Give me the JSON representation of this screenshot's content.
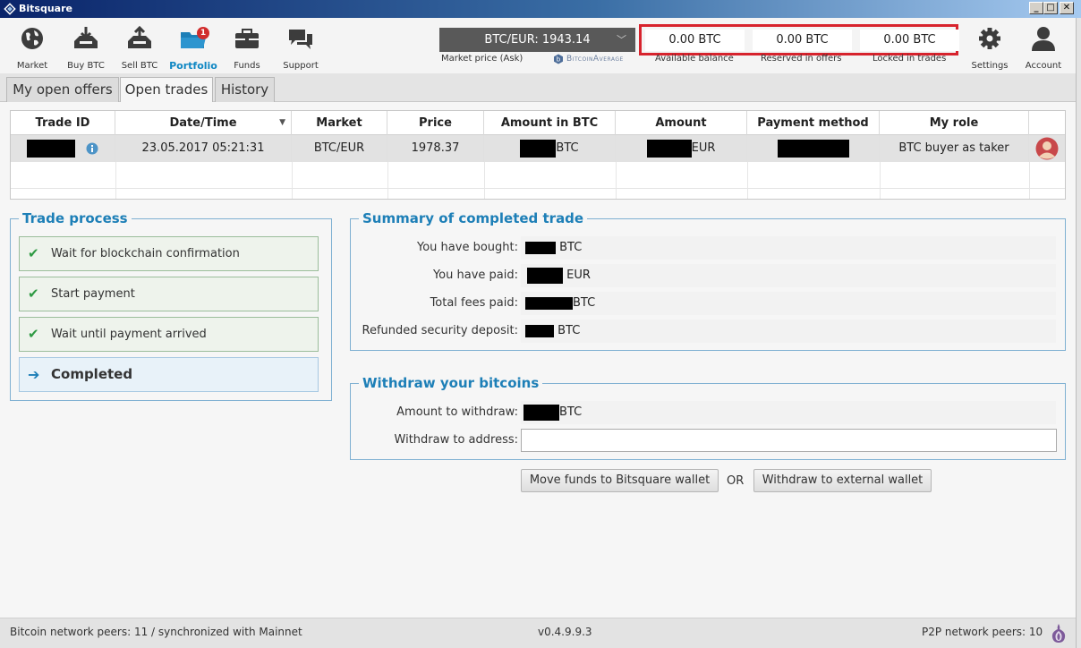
{
  "window": {
    "title": "Bitsquare"
  },
  "nav": {
    "market": "Market",
    "buy_btc": "Buy BTC",
    "sell_btc": "Sell BTC",
    "portfolio": "Portfolio",
    "portfolio_badge": "1",
    "funds": "Funds",
    "support": "Support",
    "settings": "Settings",
    "account": "Account"
  },
  "market_price": {
    "value": "BTC/EUR: 1943.14",
    "label": "Market price (Ask)",
    "provider": "BitcoinAverage"
  },
  "balances": {
    "available": {
      "value": "0.00 BTC",
      "label": "Available balance"
    },
    "reserved": {
      "value": "0.00 BTC",
      "label": "Reserved in offers"
    },
    "locked": {
      "value": "0.00 BTC",
      "label": "Locked in trades"
    }
  },
  "tabs": [
    "My open offers",
    "Open trades",
    "History"
  ],
  "table": {
    "headers": [
      "Trade ID",
      "Date/Time",
      "Market",
      "Price",
      "Amount in BTC",
      "Amount",
      "Payment method",
      "My role"
    ],
    "row": {
      "date": "23.05.2017 05:21:31",
      "market": "BTC/EUR",
      "price": "1978.37",
      "amount_btc_unit": "BTC",
      "amount_unit": "EUR",
      "role": "BTC buyer as taker"
    }
  },
  "trade_process": {
    "title": "Trade process",
    "steps": [
      "Wait for blockchain confirmation",
      "Start payment",
      "Wait until payment arrived",
      "Completed"
    ]
  },
  "summary": {
    "title": "Summary of completed trade",
    "bought_label": "You have bought:",
    "bought_unit": "BTC",
    "paid_label": "You have paid:",
    "paid_unit": "EUR",
    "fees_label": "Total fees paid:",
    "fees_unit": "BTC",
    "refund_label": "Refunded security deposit:",
    "refund_unit": "BTC"
  },
  "withdraw": {
    "title": "Withdraw your bitcoins",
    "amount_label": "Amount to withdraw:",
    "amount_unit": "BTC",
    "address_label": "Withdraw to address:",
    "address_value": ""
  },
  "actions": {
    "move_funds": "Move funds to Bitsquare wallet",
    "or": "OR",
    "withdraw_external": "Withdraw to external wallet"
  },
  "status": {
    "bitcoin_peers": "Bitcoin network peers: 11 / synchronized with Mainnet",
    "version": "v0.4.9.9.3",
    "p2p_peers": "P2P network peers: 10"
  },
  "colors": {
    "accent": "#1d7fb7",
    "highlight": "#d7232d",
    "check": "#2e9a43"
  }
}
